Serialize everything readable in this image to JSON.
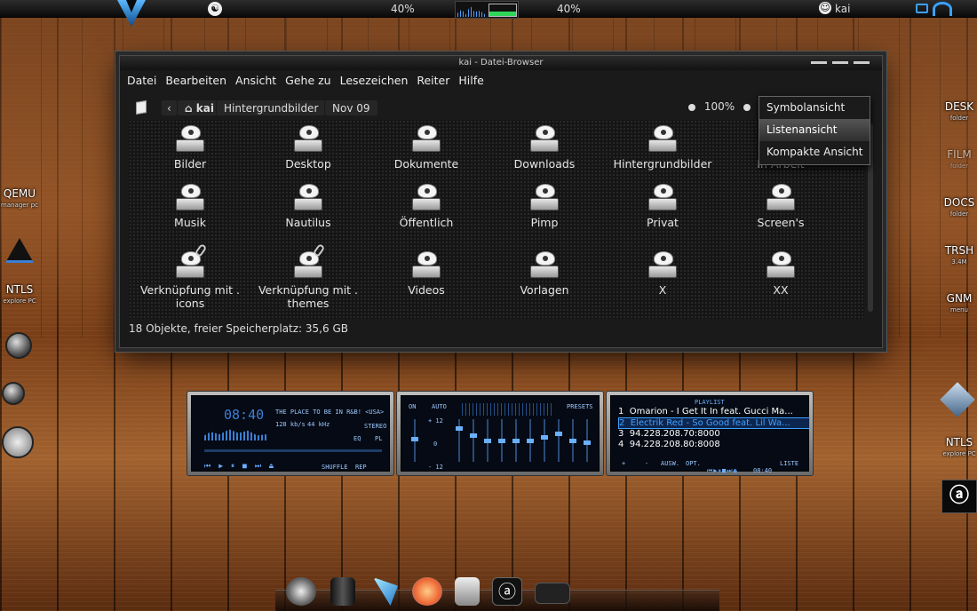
{
  "top_panel": {
    "cpu_percent_left": "40%",
    "cpu_percent_right": "40%",
    "user": "kai",
    "icons": [
      "distro-logo-icon",
      "app-menu-icon",
      "system-monitor-graph-icon",
      "user-icon",
      "network-icon",
      "wifi-icon"
    ]
  },
  "window": {
    "title": "kai - Datei-Browser",
    "menu": [
      "Datei",
      "Bearbeiten",
      "Ansicht",
      "Gehe zu",
      "Lesezeichen",
      "Reiter",
      "Hilfe"
    ],
    "breadcrumbs": [
      "kai",
      "Hintergrundbilder",
      "Nov 09"
    ],
    "zoom": "100%",
    "view_menu": [
      "Symbolansicht",
      "Listenansicht",
      "Kompakte Ansicht"
    ],
    "files": [
      {
        "name": "Bilder",
        "link": false
      },
      {
        "name": "Desktop",
        "link": false
      },
      {
        "name": "Dokumente",
        "link": false
      },
      {
        "name": "Downloads",
        "link": false
      },
      {
        "name": "Hintergrundbilder",
        "link": false
      },
      {
        "name": "In Arbeit",
        "link": false
      },
      {
        "name": "Musik",
        "link": false
      },
      {
        "name": "Nautilus",
        "link": false
      },
      {
        "name": "Öffentlich",
        "link": false
      },
      {
        "name": "Pimp",
        "link": false
      },
      {
        "name": "Privat",
        "link": false
      },
      {
        "name": "Screen's",
        "link": false
      },
      {
        "name": "Verknüpfung mit . icons",
        "link": true
      },
      {
        "name": "Verknüpfung mit . themes",
        "link": true
      },
      {
        "name": "Videos",
        "link": false
      },
      {
        "name": "Vorlagen",
        "link": false
      },
      {
        "name": "X",
        "link": false
      },
      {
        "name": "XX",
        "link": false
      }
    ],
    "status": "18 Objekte, freier Speicherplatz: 35,6 GB"
  },
  "desktop": {
    "left": [
      {
        "label": "QEMU",
        "sub": "manager pc"
      },
      {
        "label": "NTLS",
        "sub": "explore PC"
      }
    ],
    "right": [
      {
        "label": "DESK",
        "sub": "folder"
      },
      {
        "label": "FILM",
        "sub": "folder"
      },
      {
        "label": "DOCS",
        "sub": "folder"
      },
      {
        "label": "TRSH",
        "sub": "3.4M"
      },
      {
        "label": "GNM",
        "sub": "menu"
      },
      {
        "label": "NTLS",
        "sub": "explore PC"
      }
    ]
  },
  "player": {
    "time": "08:40",
    "track": "THE PLACE TO BE IN R&B! <USA>",
    "bitrate": "128 kb/s",
    "samplerate": "44 kHz",
    "stereo": "STEREO",
    "eq_label": "EQ",
    "pl_label": "PL",
    "shuffle": "SHUFFLE",
    "rep": "REP",
    "eq_on": "ON",
    "eq_auto": "AUTO",
    "eq_presets": "PRESETS",
    "eq_plus": "+ 12",
    "eq_zero": "0",
    "eq_minus": "- 12",
    "playlist_title": "PLAYLIST",
    "playlist": [
      {
        "n": "1",
        "t": "Omarion - I Get It In feat. Gucci Ma..."
      },
      {
        "n": "2",
        "t": "Electrik Red - So Good feat. Lil Wa..."
      },
      {
        "n": "3",
        "t": "94.228.208.70:8000"
      },
      {
        "n": "4",
        "t": "94.228.208.80:8008"
      }
    ],
    "pl_add": "+",
    "pl_rem": "-",
    "pl_sel": "AUSW.",
    "pl_opt": "OPT.",
    "pl_time": "08:40",
    "pl_list": "LISTE"
  },
  "colors": {
    "accent": "#3fa2ff",
    "panel": "#1a1a1a",
    "wood": "#8a4d22"
  }
}
